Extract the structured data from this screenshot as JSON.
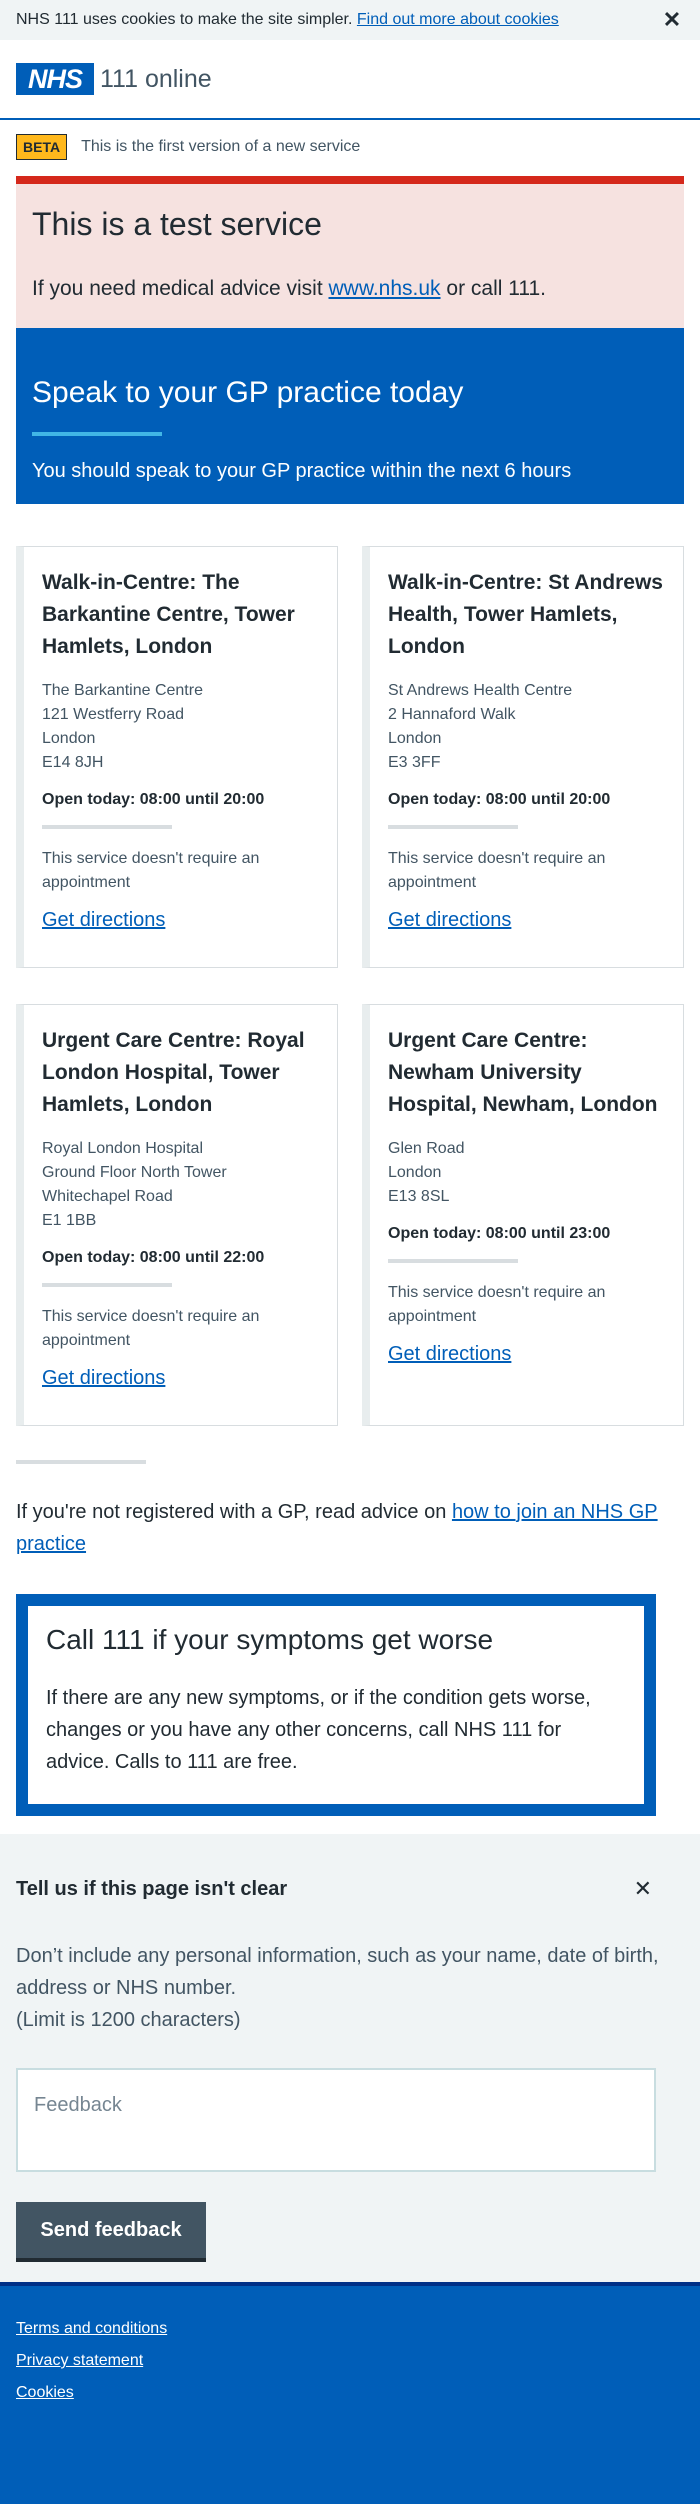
{
  "cookie_banner": {
    "text": "NHS 111 uses cookies to make the site simpler.",
    "link": "Find out more about cookies",
    "close": "✕"
  },
  "header": {
    "logo": "NHS",
    "service_name": "111 online"
  },
  "phase": {
    "tag": "BETA",
    "text": "This is the first version of a new service"
  },
  "test_banner": {
    "title": "This is a test service",
    "body_prefix": "If you need medical advice visit",
    "link": "www.nhs.uk",
    "body_suffix": "or call 111."
  },
  "disposition": {
    "title": "Speak to your GP practice today",
    "subtitle": "You should speak to your GP practice within the next 6 hours"
  },
  "services": [
    {
      "name": "Walk-in-Centre: The Barkantine Centre, Tower Hamlets, London",
      "address": [
        "The Barkantine Centre",
        "121 Westferry Road",
        "London",
        "E14 8JH"
      ],
      "hours": "Open today: 08:00 until 20:00",
      "note": "This service doesn't require an appointment",
      "link": "Get directions"
    },
    {
      "name": "Walk-in-Centre: St Andrews Health, Tower Hamlets, London",
      "address": [
        "St Andrews Health Centre",
        "2 Hannaford Walk",
        "London",
        "E3 3FF"
      ],
      "hours": "Open today: 08:00 until 20:00",
      "note": "This service doesn't require an appointment",
      "link": "Get directions"
    },
    {
      "name": "Urgent Care Centre: Royal London Hospital, Tower Hamlets, London",
      "address": [
        "Royal London Hospital",
        "Ground Floor North Tower",
        "Whitechapel Road",
        "E1 1BB"
      ],
      "hours": "Open today: 08:00 until 22:00",
      "note": "This service doesn't require an appointment",
      "link": "Get directions"
    },
    {
      "name": "Urgent Care Centre: Newham University Hospital, Newham, London",
      "address": [
        "Glen Road",
        "London",
        "E13 8SL"
      ],
      "hours": "Open today: 08:00 until 23:00",
      "note": "This service doesn't require an appointment",
      "link": "Get directions"
    }
  ],
  "gp_advice": {
    "prefix": "If you're not registered with a GP, read advice on",
    "link": "how to join an NHS GP practice"
  },
  "worsening": {
    "title": "Call 111 if your symptoms get worse",
    "body": "If there are any new symptoms, or if the condition gets worse, changes or you have any other concerns, call NHS 111 for advice. Calls to 111 are free."
  },
  "feedback": {
    "title": "Tell us if this page isn't clear",
    "close": "✕",
    "note_line1": "Don’t include any personal information, such as your name, date of birth, address or NHS number.",
    "note_line2": "(Limit is 1200 characters)",
    "placeholder": "Feedback",
    "button": "Send feedback"
  },
  "footer": {
    "links": [
      "Terms and conditions",
      "Privacy statement",
      "Cookies"
    ]
  }
}
